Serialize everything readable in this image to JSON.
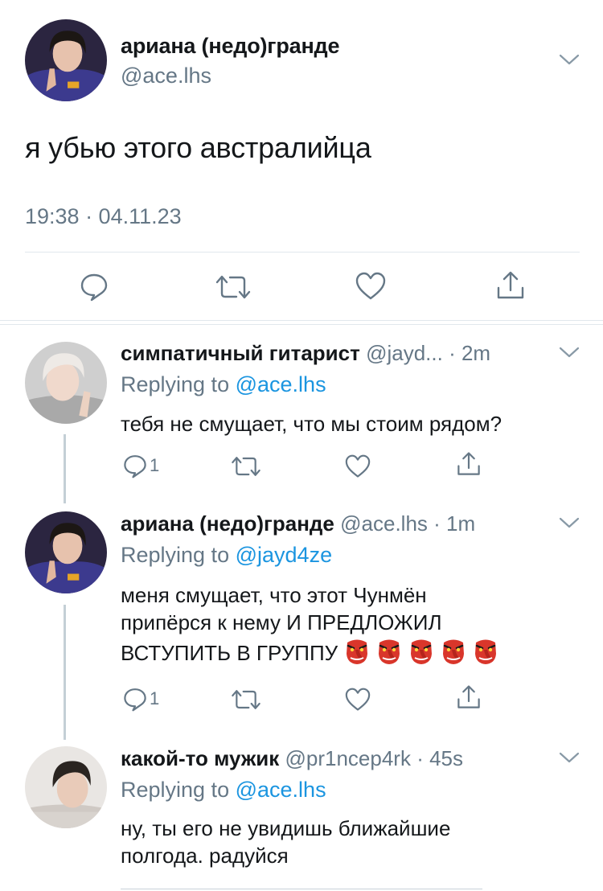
{
  "main_tweet": {
    "name": "ариана (недо)гранде",
    "handle": "@ace.lhs",
    "text": "я убью этого австралийца",
    "timestamp": "19:38 · 04.11.23",
    "actions": [
      "reply-icon",
      "retweet-icon",
      "like-icon",
      "share-icon"
    ]
  },
  "replies": [
    {
      "name": "симпатичный гитарист",
      "handle": "@jayd...",
      "age": "· 2m",
      "replying_prefix": "Replying to",
      "replying_to": "@ace.lhs",
      "text": "тебя не смущает, что мы стоим рядом?",
      "reply_count": "1"
    },
    {
      "name": "ариана (недо)гранде",
      "handle": "@ace.lhs",
      "age": "· 1m",
      "replying_prefix": "Replying to",
      "replying_to": "@jayd4ze",
      "text_line1": "меня смущает, что этот Чунмён",
      "text_line2": "припёрся к нему И ПРЕДЛОЖИЛ",
      "text_line3": "ВСТУПИТЬ В ГРУППУ",
      "emoji": "tengu-mask-icon",
      "emoji_count": 5,
      "reply_count": "1"
    },
    {
      "name": "какой-то мужик",
      "handle": "@pr1ncep4rk",
      "age": "· 45s",
      "replying_prefix": "Replying to",
      "replying_to": "@ace.lhs",
      "text_line1": "ну, ты его не увидишь ближайшие",
      "text_line2": "полгода. радуйся"
    }
  ],
  "colors": {
    "text": "#14171a",
    "secondary": "#657786",
    "link": "#1b95e0",
    "divider": "#e1e8ed",
    "thread_line": "#c4cfd6"
  }
}
